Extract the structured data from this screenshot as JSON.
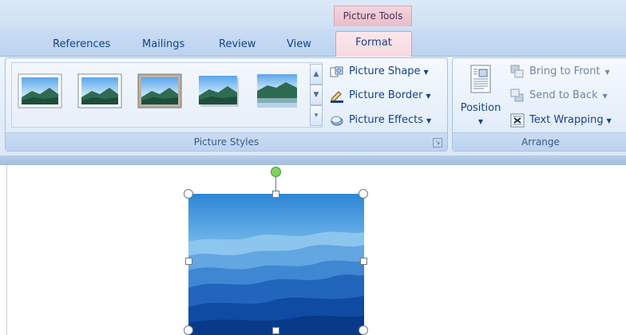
{
  "context_tab": {
    "label": "Picture Tools"
  },
  "tabs": [
    {
      "label": "References"
    },
    {
      "label": "Mailings"
    },
    {
      "label": "Review"
    },
    {
      "label": "View"
    },
    {
      "label": "Format"
    }
  ],
  "picture_styles_group": {
    "label": "Picture Styles",
    "commands": [
      {
        "label": "Picture Shape",
        "icon": "picture-shape-icon"
      },
      {
        "label": "Picture Border",
        "icon": "picture-border-icon"
      },
      {
        "label": "Picture Effects",
        "icon": "picture-effects-icon"
      }
    ]
  },
  "arrange_group": {
    "label": "Arrange",
    "position_label": "Position",
    "commands": [
      {
        "label": "Bring to Front",
        "icon": "bring-to-front-icon"
      },
      {
        "label": "Send to Back",
        "icon": "send-to-back-icon"
      },
      {
        "label": "Text Wrapping",
        "icon": "text-wrapping-icon"
      }
    ]
  },
  "colors": {
    "accent_context": "#e9bcc8",
    "ribbon": "#dbe8f7",
    "text": "#15428b"
  }
}
